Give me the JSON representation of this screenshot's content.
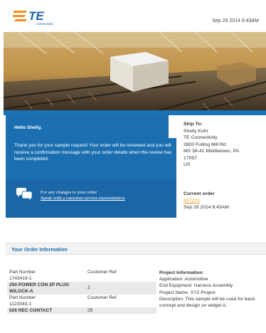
{
  "header": {
    "date": "Sep 29 2014 6:43AM",
    "logo_brand": "TE",
    "logo_sub": "connectivity"
  },
  "colors": {
    "brand_blue": "#1b6fb0",
    "brand_orange": "#f28c1e",
    "link_orange": "#e89a1a"
  },
  "message": {
    "greeting": "Hello Shelly,",
    "body": "Thank you for your sample request! Your order will be reviewed and you will receive a confirmation message with your order details when the review has been completed."
  },
  "contact": {
    "icon": "chat-bubbles-icon",
    "line1": "For any changes to your order",
    "line2": "Speak with a customer service representative"
  },
  "ship_to": {
    "title": "Ship To:",
    "lines": [
      "Shelly Kohr",
      "TE Connectivity",
      "2800 Fulling Mill Rd",
      "MS 38-41 Middletown, PA",
      "17057",
      "US"
    ]
  },
  "current_order": {
    "title": "Current order",
    "number": "537273",
    "date": "Sep 29 2014 6:43AM"
  },
  "section": {
    "title": "Your Order Information"
  },
  "table": {
    "col_part": "Part Number",
    "col_ref": "Customer Ref",
    "items": [
      {
        "part_number": "1743419-1",
        "description": "250 POWER CON 2P PLUG W/LOCK-A",
        "qty": "2"
      },
      {
        "part_number": "1123343-1",
        "description": "026 REC CONTACT",
        "qty": "25"
      }
    ]
  },
  "project": {
    "title": "Project Information:",
    "application": "Application: Automotive",
    "end_equipment": "End Equipment: Harness Assembly",
    "project_name": "Project Name: XYZ Project",
    "description": "Description: This sample will be used for basic concept and design on widget A."
  }
}
